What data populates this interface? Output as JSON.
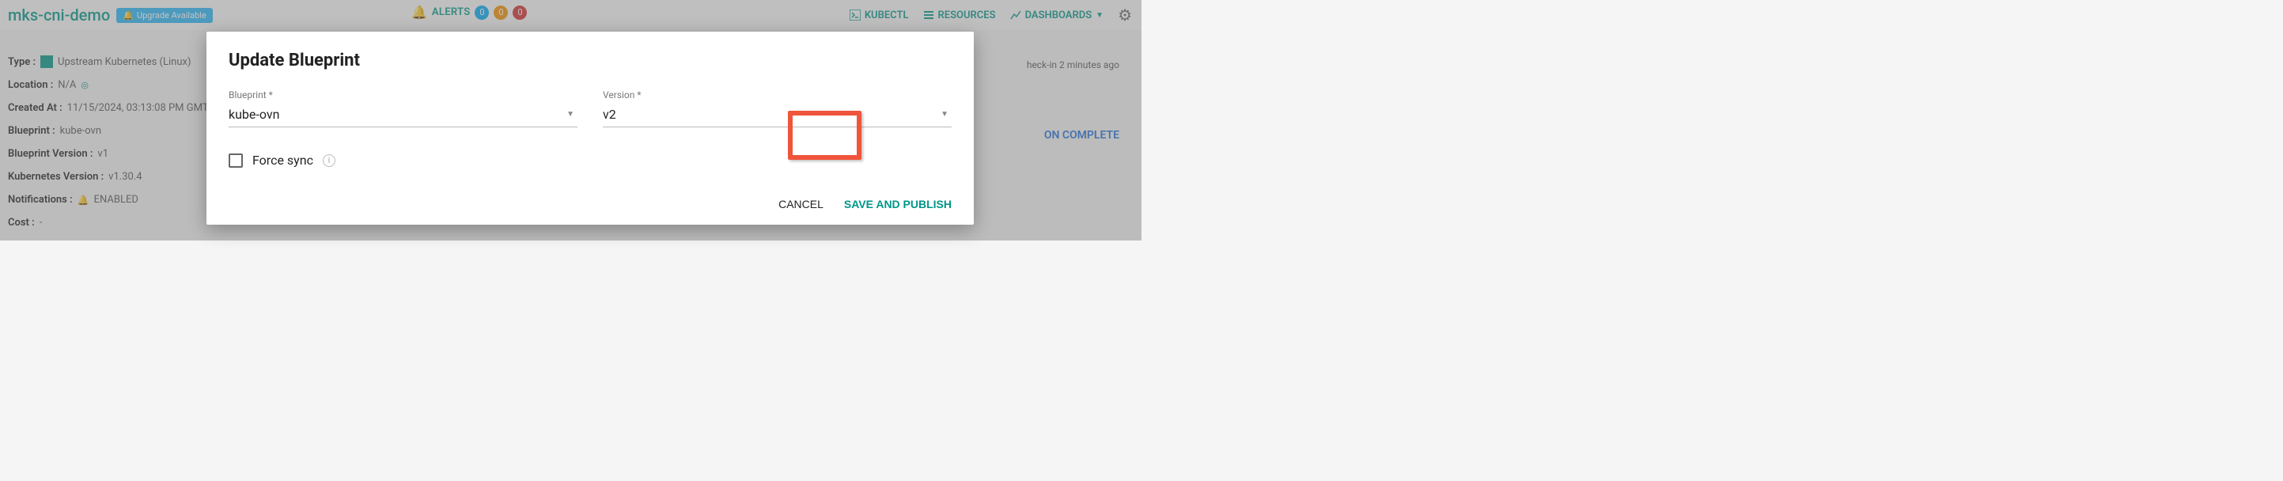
{
  "header": {
    "cluster_name": "mks-cni-demo",
    "upgrade_badge": "Upgrade Available",
    "alerts_label": "ALERTS",
    "alert_counts": {
      "info": "0",
      "warn": "0",
      "crit": "0"
    },
    "nav": {
      "kubectl": "KUBECTL",
      "resources": "RESOURCES",
      "dashboards": "DASHBOARDS"
    }
  },
  "details": {
    "type_label": "Type :",
    "type_value": "Upstream Kubernetes (Linux)",
    "location_label": "Location :",
    "location_value": "N/A",
    "created_label": "Created At :",
    "created_value": "11/15/2024, 03:13:08 PM GMT",
    "blueprint_label": "Blueprint :",
    "blueprint_value": "kube-ovn",
    "bpver_label": "Blueprint Version :",
    "bpver_value": "v1",
    "k8sver_label": "Kubernetes Version :",
    "k8sver_value": "v1.30.4",
    "notifications_label": "Notifications :",
    "notifications_value": "ENABLED",
    "cost_label": "Cost :",
    "cost_value": "-"
  },
  "checkin_prefix": "heck-in",
  "checkin_time": "2 minutes ago",
  "complete_link": "ON COMPLETE",
  "modal": {
    "title": "Update Blueprint",
    "blueprint_label": "Blueprint *",
    "blueprint_value": "kube-ovn",
    "version_label": "Version *",
    "version_value": "v2",
    "force_sync_label": "Force sync",
    "cancel": "CANCEL",
    "save": "SAVE AND PUBLISH"
  }
}
